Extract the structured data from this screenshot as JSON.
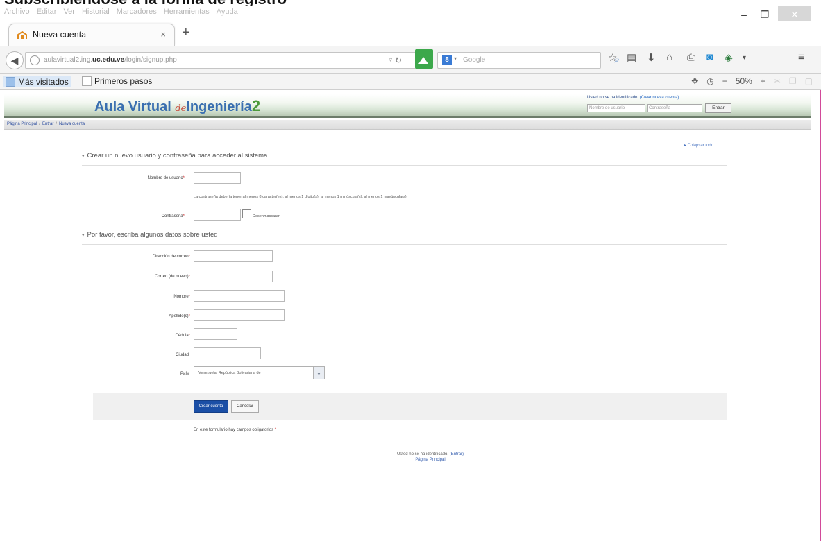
{
  "caption": "Subscribiéndose a la forma de registro",
  "menubar": {
    "items": [
      "Archivo",
      "Editar",
      "Ver",
      "Historial",
      "Marcadores",
      "Herramientas",
      "Ayuda"
    ],
    "min": "–",
    "max": "❐",
    "close": "✕"
  },
  "tab": {
    "title": "Nueva cuenta",
    "close": "×",
    "new": "+"
  },
  "navbar": {
    "url_prefix": "aulavirtual2.ing.",
    "url_domain": "uc.edu.ve",
    "url_suffix": "/login/signup.php",
    "search_placeholder": "Google"
  },
  "bookmarks": {
    "most_visited": "Más visitados",
    "first_steps": "Primeros pasos",
    "zoom": "50%"
  },
  "site": {
    "logo_main": "Aula Virtual",
    "logo_de": "de",
    "logo_second": "Ingeniería",
    "logo_num": "2",
    "login_msg": "Usted no se ha identificado.",
    "login_link": "(Crear nueva cuenta)",
    "username_ph": "Nombre de usuario",
    "password_ph": "Contraseña",
    "login_btn": "Entrar"
  },
  "breadcrumb": {
    "home": "Página Principal",
    "login": "Entrar",
    "current": "Nueva cuenta"
  },
  "collapse_all": "▸ Colapsar todo",
  "section1": {
    "title": "Crear un nuevo usuario y contraseña para acceder al sistema",
    "username_label": "Nombre de usuario",
    "password_note": "La contraseña debería tener al menos 8 caracter(es), al menos 1 dígito(s), al menos 1 minúscula(s), al menos 1 mayúscula(s)",
    "password_label": "Contraseña",
    "unmask_label": "Desenmascarar"
  },
  "section2": {
    "title": "Por favor, escriba algunos datos sobre usted",
    "email_label": "Dirección de correo",
    "email2_label": "Correo (de nuevo)",
    "firstname_label": "Nombre",
    "lastname_label": "Apellido(s)",
    "id_label": "Cédula",
    "city_label": "Ciudad",
    "country_label": "País",
    "country_value": "Venezuela, República Bolivariana de"
  },
  "buttons": {
    "create": "Crear cuenta",
    "cancel": "Cancelar"
  },
  "required_note": "En este formulario hay campos obligatorios",
  "footer": {
    "not_logged": "Usted no se ha identificado.",
    "login_link": "(Entrar)",
    "home": "Página Principal"
  }
}
